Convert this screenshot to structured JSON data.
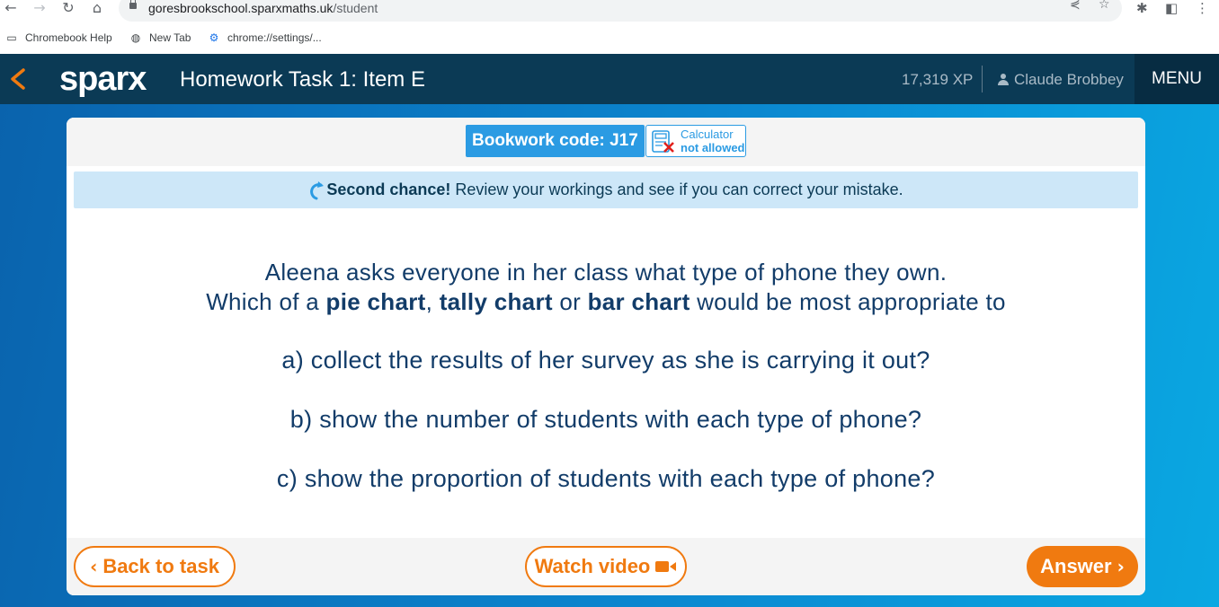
{
  "browser": {
    "url_host": "goresbrookschool.sparxmaths.uk",
    "url_path": "/student",
    "bookmarks": [
      {
        "label": "Chromebook Help",
        "icon": "folder-icon"
      },
      {
        "label": "New Tab",
        "icon": "globe-icon"
      },
      {
        "label": "chrome://settings/...",
        "icon": "settings-icon"
      }
    ]
  },
  "header": {
    "logo": "sparx",
    "title": "Homework Task 1: Item E",
    "xp": "17,319 XP",
    "user": "Claude Brobbey",
    "menu": "MENU"
  },
  "task": {
    "bookwork_code": "Bookwork code: J17",
    "calculator_line1": "Calculator",
    "calculator_line2": "not allowed",
    "second_chance_bold": "Second chance!",
    "second_chance_text": "Review your workings and see if you can correct your mistake.",
    "question_line1": "Aleena asks everyone in her class what type of phone they own.",
    "question_line2_pre": "Which of a ",
    "question_line2_b1": "pie chart",
    "question_line2_sep1": ", ",
    "question_line2_b2": "tally chart",
    "question_line2_sep2": " or ",
    "question_line2_b3": "bar chart",
    "question_line2_post": " would be most appropriate to",
    "part_a": "a) collect the results of her survey as she is carrying it out?",
    "part_b": "b) show the number of students with each type of phone?",
    "part_c": "c) show the proportion of students with each type of phone?"
  },
  "actions": {
    "back": "Back to task",
    "video": "Watch video",
    "answer": "Answer"
  },
  "colors": {
    "header_bg": "#0b3a55",
    "accent_orange": "#f07a10",
    "accent_blue": "#2b9be3",
    "text_navy": "#123c69"
  }
}
